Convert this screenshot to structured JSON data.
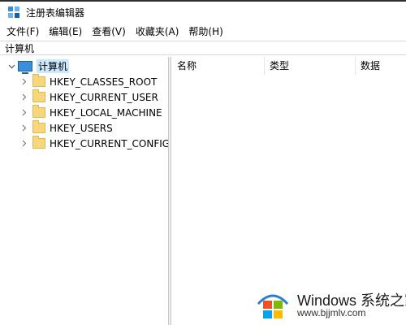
{
  "window": {
    "title": "注册表编辑器"
  },
  "menu": [
    "文件(F)",
    "编辑(E)",
    "查看(V)",
    "收藏夹(A)",
    "帮助(H)"
  ],
  "address_bar": {
    "path": "计算机"
  },
  "tree": {
    "root": {
      "label": "计算机",
      "icon": "computer-icon",
      "expanded": true
    },
    "keys": [
      {
        "label": "HKEY_CLASSES_ROOT",
        "icon": "folder-icon"
      },
      {
        "label": "HKEY_CURRENT_USER",
        "icon": "folder-icon"
      },
      {
        "label": "HKEY_LOCAL_MACHINE",
        "icon": "folder-icon"
      },
      {
        "label": "HKEY_USERS",
        "icon": "folder-icon"
      },
      {
        "label": "HKEY_CURRENT_CONFIG",
        "icon": "folder-icon"
      }
    ]
  },
  "list": {
    "columns": [
      "名称",
      "类型",
      "数据"
    ]
  },
  "watermark": {
    "brand": "Windows 系统之家",
    "url": "www.bjjmlv.com"
  },
  "colors": {
    "selection": "#cce8ff",
    "folder": "#f5d77e",
    "accent": "#3a8fd8"
  }
}
